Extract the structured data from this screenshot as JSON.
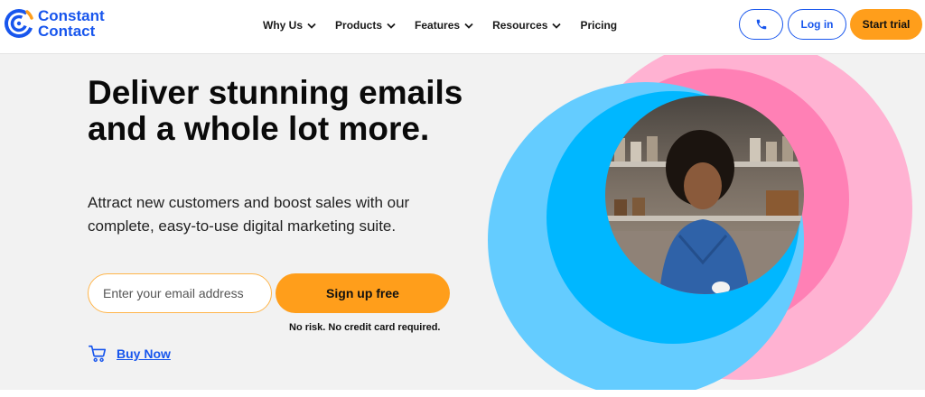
{
  "brand": {
    "line1": "Constant",
    "line2": "Contact",
    "color": "#1856ed"
  },
  "nav": {
    "items": [
      {
        "label": "Why Us",
        "has_dropdown": true
      },
      {
        "label": "Products",
        "has_dropdown": true
      },
      {
        "label": "Features",
        "has_dropdown": true
      },
      {
        "label": "Resources",
        "has_dropdown": true
      },
      {
        "label": "Pricing",
        "has_dropdown": false
      }
    ]
  },
  "actions": {
    "phone_icon": "phone-icon",
    "login_label": "Log in",
    "trial_label": "Start trial"
  },
  "hero": {
    "title": "Deliver stunning emails and a whole lot more.",
    "subtitle": "Attract new customers and boost sales with our complete, easy-to-use digital marketing suite.",
    "email_placeholder": "Enter your email address",
    "email_value": "",
    "signup_label": "Sign up free",
    "disclaimer": "No risk. No credit card required.",
    "buy_now_label": "Buy Now",
    "buy_now_icon": "cart-icon"
  },
  "colors": {
    "accent_orange": "#ff9e1b",
    "brand_blue": "#1856ed",
    "circle_blue": "#00b7ff",
    "circle_pink": "#ff7eb6"
  }
}
